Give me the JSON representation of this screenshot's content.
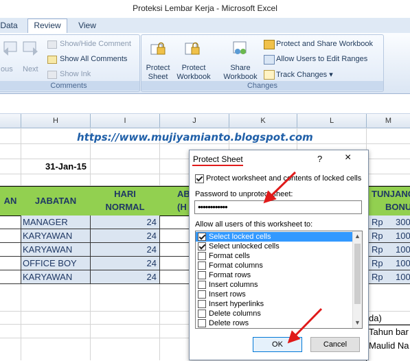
{
  "window": {
    "title": "Proteksi Lembar Kerja - Microsoft Excel"
  },
  "tabs": [
    {
      "label": "Data"
    },
    {
      "label": "Review"
    },
    {
      "label": "View"
    }
  ],
  "ribbon": {
    "previous_label": "ous",
    "next_label": "Next",
    "show_hide_comment": "Show/Hide Comment",
    "show_all_comments": "Show All Comments",
    "show_ink": "Show Ink",
    "comments_group": "Comments",
    "protect_sheet": [
      "Protect",
      "Sheet"
    ],
    "protect_workbook": [
      "Protect",
      "Workbook"
    ],
    "share_workbook": [
      "Share",
      "Workbook"
    ],
    "protect_and_share": "Protect and Share Workbook",
    "allow_users": "Allow Users to Edit Ranges",
    "track_changes": "Track Changes",
    "changes_group": "Changes"
  },
  "columns": [
    "H",
    "I",
    "J",
    "K",
    "L",
    "M"
  ],
  "sheet": {
    "url": "https://www.mujiyamianto.blogspot.com",
    "date": "31-Jan-15",
    "header_an": "AN",
    "header_jabatan": "JABATAN",
    "header_hari": [
      "HARI",
      "NORMAL"
    ],
    "header_ab": [
      "AB",
      "(H"
    ],
    "header_tunjangan": [
      "TUNJANG",
      "BONU"
    ],
    "rows": [
      {
        "jabatan": "MANAGER",
        "hari": "24",
        "rp": "Rp",
        "amt": "300"
      },
      {
        "jabatan": "KARYAWAN",
        "hari": "24",
        "rp": "Rp",
        "amt": "100"
      },
      {
        "jabatan": "KARYAWAN",
        "hari": "24",
        "rp": "Rp",
        "amt": "100"
      },
      {
        "jabatan": "OFFICE BOY",
        "hari": "24",
        "rp": "Rp",
        "amt": "100"
      },
      {
        "jabatan": "KARYAWAN",
        "hari": "24",
        "rp": "Rp",
        "amt": "100"
      }
    ],
    "side_texts": [
      "da)",
      "Tahun bar",
      "Maulid Na"
    ]
  },
  "dialog": {
    "title": "Protect Sheet",
    "help": "?",
    "close": "×",
    "protect_check": "Protect worksheet and contents of locked cells",
    "password_label": "Password to unprotect sheet:",
    "password_value": "••••••••••••",
    "allow_label": "Allow all users of this worksheet to:",
    "options": [
      {
        "label": "Select locked cells",
        "checked": true
      },
      {
        "label": "Select unlocked cells",
        "checked": true
      },
      {
        "label": "Format cells",
        "checked": false
      },
      {
        "label": "Format columns",
        "checked": false
      },
      {
        "label": "Format rows",
        "checked": false
      },
      {
        "label": "Insert columns",
        "checked": false
      },
      {
        "label": "Insert rows",
        "checked": false
      },
      {
        "label": "Insert hyperlinks",
        "checked": false
      },
      {
        "label": "Delete columns",
        "checked": false
      },
      {
        "label": "Delete rows",
        "checked": false
      }
    ],
    "ok": "OK",
    "cancel": "Cancel"
  },
  "colors": {
    "header_green": "#92d050",
    "annotation_red": "#e01a1a",
    "link_blue": "#1f5fa8"
  }
}
